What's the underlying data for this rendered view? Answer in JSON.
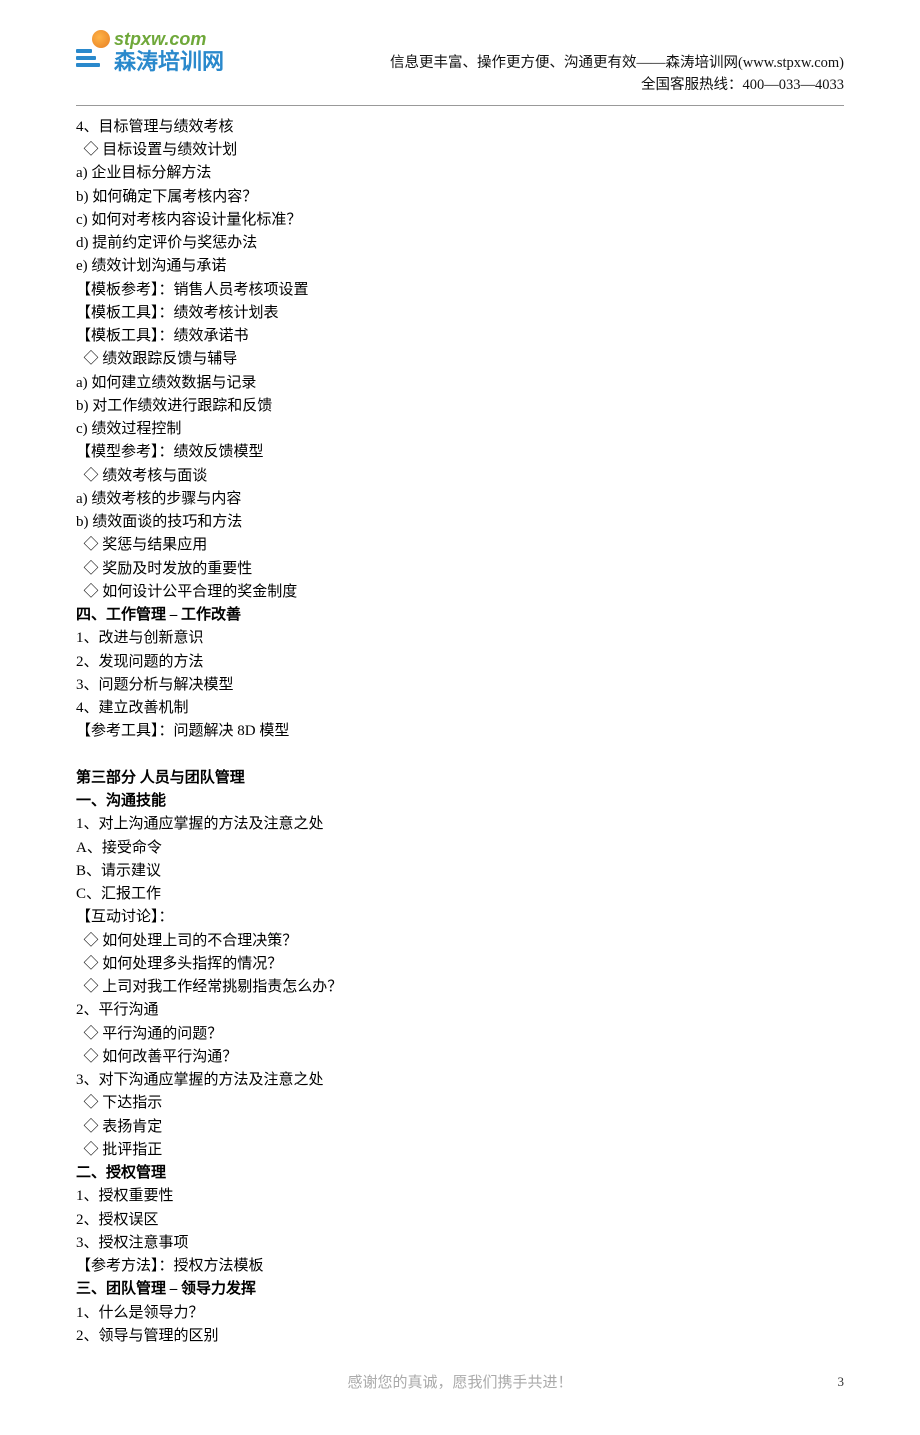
{
  "header": {
    "logo_url": "stpxw.com",
    "logo_cn": "森涛培训网",
    "line1": "信息更丰富、操作更方便、沟通更有效——森涛培训网(www.stpxw.com)",
    "line2": "全国客服热线：400—033—4033"
  },
  "lines": [
    {
      "t": "4、目标管理与绩效考核",
      "b": false
    },
    {
      "t": "  ◇ 目标设置与绩效计划",
      "b": false
    },
    {
      "t": "a) 企业目标分解方法",
      "b": false
    },
    {
      "t": "b) 如何确定下属考核内容？",
      "b": false
    },
    {
      "t": "c) 如何对考核内容设计量化标准？",
      "b": false
    },
    {
      "t": "d) 提前约定评价与奖惩办法",
      "b": false
    },
    {
      "t": "e) 绩效计划沟通与承诺",
      "b": false
    },
    {
      "t": "【模板参考】：销售人员考核项设置",
      "b": false
    },
    {
      "t": "【模板工具】：绩效考核计划表",
      "b": false
    },
    {
      "t": "【模板工具】：绩效承诺书",
      "b": false
    },
    {
      "t": "  ◇ 绩效跟踪反馈与辅导",
      "b": false
    },
    {
      "t": "a) 如何建立绩效数据与记录",
      "b": false
    },
    {
      "t": "b) 对工作绩效进行跟踪和反馈",
      "b": false
    },
    {
      "t": "c) 绩效过程控制",
      "b": false
    },
    {
      "t": "【模型参考】：绩效反馈模型",
      "b": false
    },
    {
      "t": "  ◇ 绩效考核与面谈",
      "b": false
    },
    {
      "t": "a) 绩效考核的步骤与内容",
      "b": false
    },
    {
      "t": "b) 绩效面谈的技巧和方法",
      "b": false
    },
    {
      "t": "  ◇ 奖惩与结果应用",
      "b": false
    },
    {
      "t": "  ◇ 奖励及时发放的重要性",
      "b": false
    },
    {
      "t": "  ◇ 如何设计公平合理的奖金制度",
      "b": false
    },
    {
      "t": "四、工作管理 – 工作改善",
      "b": true
    },
    {
      "t": "1、改进与创新意识",
      "b": false
    },
    {
      "t": "2、发现问题的方法",
      "b": false
    },
    {
      "t": "3、问题分析与解决模型",
      "b": false
    },
    {
      "t": "4、建立改善机制",
      "b": false
    },
    {
      "t": "【参考工具】：问题解决 8D 模型",
      "b": false
    },
    {
      "t": "",
      "b": false
    },
    {
      "t": "第三部分 人员与团队管理",
      "b": true
    },
    {
      "t": "一、沟通技能",
      "b": true
    },
    {
      "t": "1、对上沟通应掌握的方法及注意之处",
      "b": false
    },
    {
      "t": "A、接受命令",
      "b": false
    },
    {
      "t": "B、请示建议",
      "b": false
    },
    {
      "t": "C、汇报工作",
      "b": false
    },
    {
      "t": "【互动讨论】：",
      "b": false
    },
    {
      "t": "  ◇ 如何处理上司的不合理决策？",
      "b": false
    },
    {
      "t": "  ◇ 如何处理多头指挥的情况？",
      "b": false
    },
    {
      "t": "  ◇ 上司对我工作经常挑剔指责怎么办？",
      "b": false
    },
    {
      "t": "2、平行沟通",
      "b": false
    },
    {
      "t": "  ◇ 平行沟通的问题？",
      "b": false
    },
    {
      "t": "  ◇ 如何改善平行沟通？",
      "b": false
    },
    {
      "t": "3、对下沟通应掌握的方法及注意之处",
      "b": false
    },
    {
      "t": "  ◇ 下达指示",
      "b": false
    },
    {
      "t": "  ◇ 表扬肯定",
      "b": false
    },
    {
      "t": "  ◇ 批评指正",
      "b": false
    },
    {
      "t": "二、授权管理",
      "b": true
    },
    {
      "t": "1、授权重要性",
      "b": false
    },
    {
      "t": "2、授权误区",
      "b": false
    },
    {
      "t": "3、授权注意事项",
      "b": false
    },
    {
      "t": "【参考方法】：授权方法模板",
      "b": false
    },
    {
      "t": "三、团队管理 – 领导力发挥",
      "b": true
    },
    {
      "t": "1、什么是领导力？",
      "b": false
    },
    {
      "t": "2、领导与管理的区别",
      "b": false
    }
  ],
  "footer": {
    "center": "感谢您的真诚，愿我们携手共进！",
    "page": "3"
  }
}
